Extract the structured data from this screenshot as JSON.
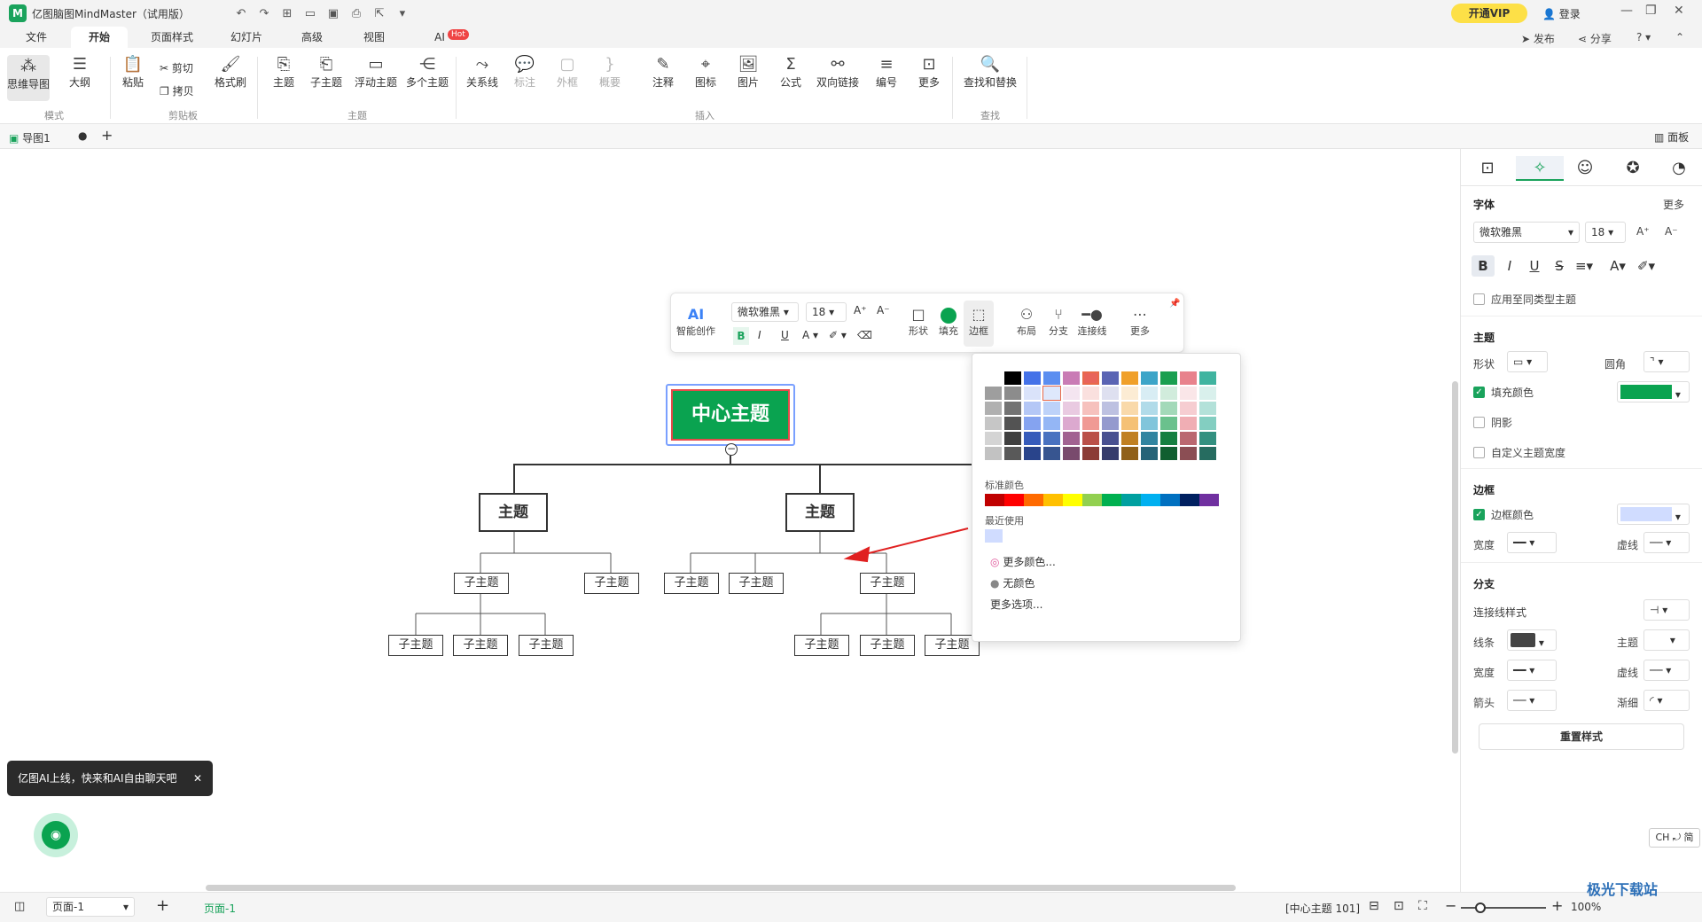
{
  "app": {
    "title": "亿图脑图MindMaster（试用版）",
    "vip": "开通VIP",
    "login": "登录"
  },
  "menu_tabs": [
    "文件",
    "开始",
    "页面样式",
    "幻灯片",
    "高级",
    "视图",
    "AI"
  ],
  "hot_badge": "Hot",
  "top_right": {
    "publish": "发布",
    "share": "分享"
  },
  "ribbon": {
    "mode": {
      "mindmap": "思维导图",
      "outline": "大纲",
      "group": "模式"
    },
    "clipboard": {
      "paste": "粘贴",
      "cut": "剪切",
      "copy": "拷贝",
      "format": "格式刷",
      "group": "剪贴板"
    },
    "topic": {
      "topic": "主题",
      "subtopic": "子主题",
      "floating": "浮动主题",
      "multi": "多个主题",
      "group": "主题"
    },
    "insert": {
      "relation": "关系线",
      "callout": "标注",
      "boundary": "外框",
      "summary": "概要",
      "note": "注释",
      "icon": "图标",
      "image": "图片",
      "formula": "公式",
      "link": "双向链接",
      "number": "编号",
      "more": "更多",
      "group": "插入"
    },
    "find": {
      "find_replace": "查找和替换",
      "group": "查找"
    }
  },
  "doc_tab": {
    "name": "导图1",
    "panel": "面板"
  },
  "mindmap": {
    "center": "中心主题",
    "main_topic": "主题",
    "sub_topic": "子主题"
  },
  "float_toolbar": {
    "ai": "智能创作",
    "font": "微软雅黑",
    "size": "18",
    "shape": "形状",
    "fill": "填充",
    "border": "边框",
    "layout": "布局",
    "branch": "分支",
    "connector": "连接线",
    "more": "更多"
  },
  "color_popup": {
    "standard_label": "标准颜色",
    "recent_label": "最近使用",
    "more_colors": "更多颜色...",
    "no_color": "无颜色",
    "more_options": "更多选项...",
    "theme_row": [
      "#ffffff",
      "#000000",
      "#4472e8",
      "#5b8ef0",
      "#c97bb5",
      "#e8645a",
      "#5a64b4",
      "#f0a02a",
      "#3da5c8",
      "#1a9f50",
      "#e8828c",
      "#40b4a0"
    ],
    "standard": [
      "#c00000",
      "#ff0000",
      "#ff6a00",
      "#ffc000",
      "#ffff00",
      "#92d050",
      "#00b050",
      "#00a0a0",
      "#00b0f0",
      "#0070c0",
      "#002060",
      "#7030a0"
    ],
    "recent": [
      "#d0dcff"
    ]
  },
  "right_panel": {
    "font_section": "字体",
    "more": "更多",
    "font": "微软雅黑",
    "size": "18",
    "apply_same": "应用至同类型主题",
    "topic_section": "主题",
    "shape": "形状",
    "corner": "圆角",
    "fill_color": "填充颜色",
    "shadow": "阴影",
    "custom_width": "自定义主题宽度",
    "border_section": "边框",
    "border_color": "边框颜色",
    "width": "宽度",
    "dash": "虚线",
    "branch_section": "分支",
    "connector_style": "连接线样式",
    "line": "线条",
    "topic": "主题",
    "arrow": "箭头",
    "taper": "渐细",
    "reset": "重置样式",
    "fill_hex": "#0aa350",
    "border_hex": "#d0dcff"
  },
  "ai_tip": "亿图AI上线，快来和AI自由聊天吧",
  "status": {
    "page_select": "页面-1",
    "page_tab": "页面-1",
    "selection": "[中心主题 101]",
    "zoom": "100%",
    "ime": "CH ⤾ 简"
  },
  "watermark": "极光下载站"
}
